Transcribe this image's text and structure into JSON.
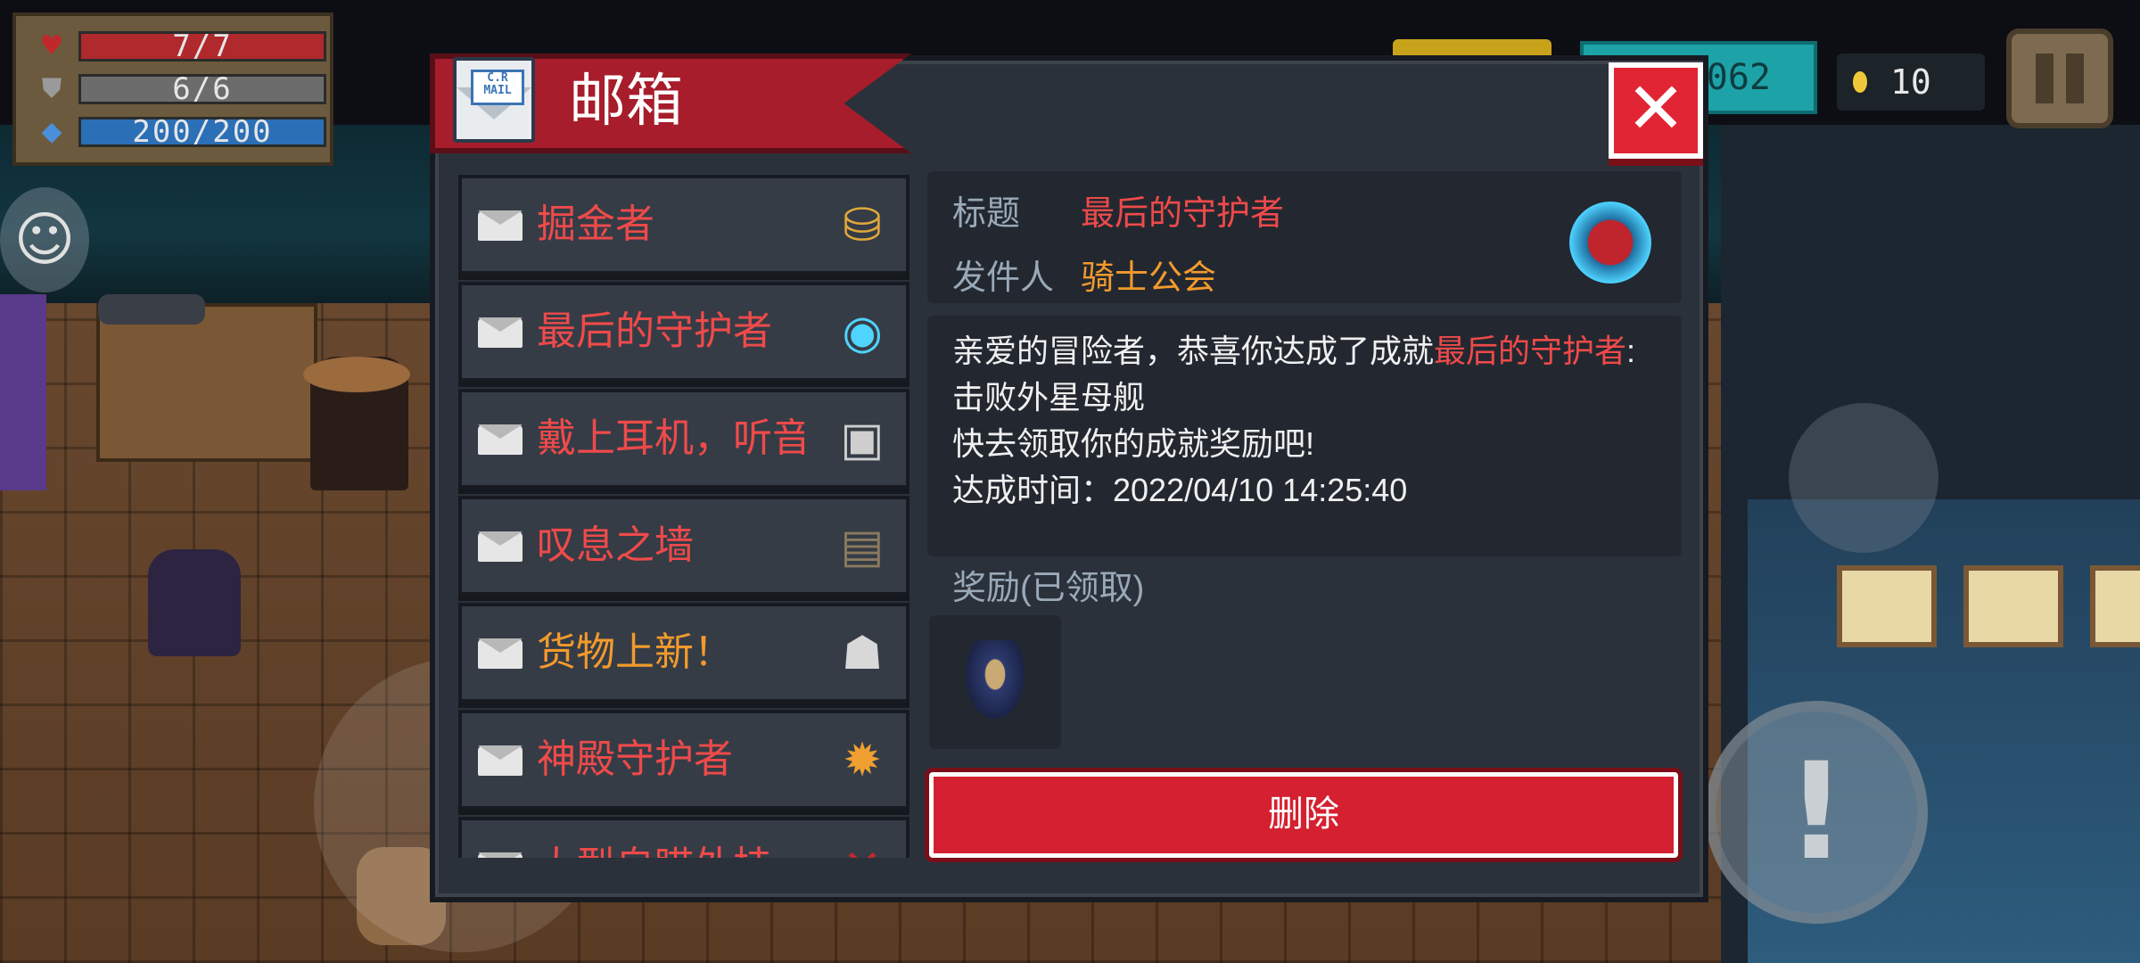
{
  "hud": {
    "hp": "7/7",
    "armor": "6/6",
    "energy": "200/200",
    "gems": "062",
    "coins": "10"
  },
  "mailbox": {
    "title": "邮箱",
    "logo_text": "C.R MAIL",
    "close_label": "✕",
    "mails": [
      {
        "subject": "掘金者",
        "color": "red",
        "thumb": "gold-pile-icon"
      },
      {
        "subject": "最后的守护者",
        "color": "red",
        "thumb": "mothership-orb-icon"
      },
      {
        "subject": "戴上耳机，听音",
        "color": "red",
        "thumb": "music-box-icon"
      },
      {
        "subject": "叹息之墙",
        "color": "red",
        "thumb": "wall-icon"
      },
      {
        "subject": "货物上新！",
        "color": "orange",
        "thumb": "merchant-icon"
      },
      {
        "subject": "神殿守护者",
        "color": "red",
        "thumb": "temple-guardian-icon"
      },
      {
        "subject": "大型自瞄外挂",
        "color": "red",
        "thumb": "weapon-icon"
      }
    ],
    "detail": {
      "title_key": "标题",
      "title_value": "最后的守护者",
      "sender_key": "发件人",
      "sender_value": "骑士公会",
      "body_line1_prefix": "亲爱的冒险者，恭喜你达成了成就",
      "body_line1_highlight": "最后的守护者",
      "body_line1_suffix": ":",
      "body_line2": "击败外星母舰",
      "body_line3": "快去领取你的成就奖励吧!",
      "body_line4": "达成时间：2022/04/10 14:25:40",
      "reward_label": "奖励(已领取)",
      "delete_label": "删除"
    }
  }
}
